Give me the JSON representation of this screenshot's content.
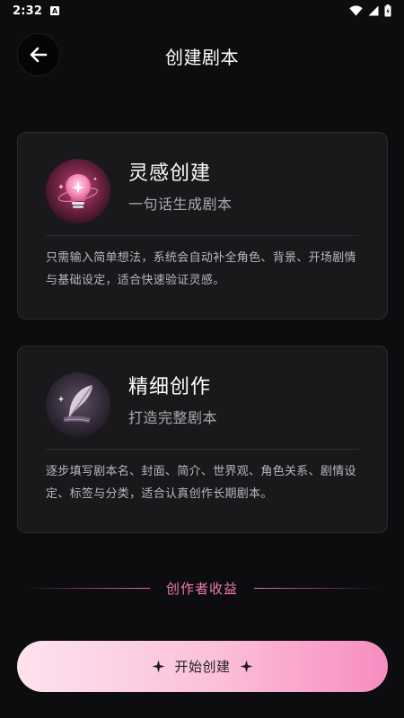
{
  "status_bar": {
    "time": "2:32",
    "notification_badge": "A"
  },
  "header": {
    "title": "创建剧本"
  },
  "cards": [
    {
      "title": "灵感创建",
      "subtitle": "一句话生成剧本",
      "description": "只需输入简单想法，系统会自动补全角色、背景、开场剧情与基础设定，适合快速验证灵感。",
      "icon": "lightbulb-icon"
    },
    {
      "title": "精细创作",
      "subtitle": "打造完整剧本",
      "description": "逐步填写剧本名、封面、简介、世界观、角色关系、剧情设定、标签与分类，适合认真创作长期剧本。",
      "icon": "feather-quill-icon"
    }
  ],
  "earnings": {
    "label": "创作者收益"
  },
  "start_button": {
    "label": "开始创建"
  },
  "colors": {
    "background": "#0d0d0f",
    "card": "#19191b",
    "accent_pink": "#f07ab4",
    "button_gradient_start": "#fde3ee",
    "button_gradient_end": "#f78cc0"
  }
}
